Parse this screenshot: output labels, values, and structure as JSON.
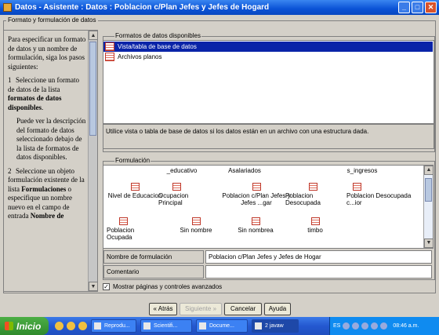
{
  "window": {
    "title": "Datos - Asistente : Datos : Poblacion c/Plan Jefes y Jefes de Hogard",
    "buttons": {
      "minimize": "_",
      "maximize": "□",
      "close": "✕"
    }
  },
  "group_title": "Formato y formulación de datos",
  "help": {
    "intro": "Para especificar un formato de datos y un nombre de formulación, siga los pasos siguientes:",
    "step1_num": "1",
    "step1_a": "Seleccione un formato de datos de la lista ",
    "step1_b": "formatos de datos disponibles",
    "step1_c": ".",
    "step1_note": "Puede ver la descripción del formato de datos seleccionado debajo de la lista de formatos de datos disponibles.",
    "step2_num": "2",
    "step2_a": "Seleccione un objeto formulación existente de la lista ",
    "step2_b": "Formulaciones",
    "step2_c": " o especifique un nombre nuevo en el campo de entrada ",
    "step2_d": "Nombre de"
  },
  "formats": {
    "label": "Formatos de datos disponibles",
    "items": [
      "Vista/tabla de base de datos",
      "Archivos planos"
    ],
    "selected": 0,
    "description": "Utilice vista o tabla de base de datos si los datos están en un archivo con una estructura dada."
  },
  "formulacion": {
    "label": "Formulación",
    "top_row": [
      "_educativo",
      "Asalariados",
      "s_ingresos"
    ],
    "items": [
      "Nivel de Educacion",
      "Ocupacion Principal",
      "Poblacion c/Plan Jefes y Jefes ...gar",
      "Poblacion Desocupada",
      "Poblacion Desocupada c...ior",
      "Poblacion Ocupada",
      "Sin nombre",
      "Sin nombrea",
      "timbo"
    ]
  },
  "fields": {
    "name_label": "Nombre de formulación",
    "name_value": "Poblacion c/Plan Jefes y Jefes de Hogar",
    "comment_label": "Comentario",
    "comment_value": ""
  },
  "advanced_checkbox": {
    "label": "Mostrar páginas y controles avanzados",
    "checked": "✓"
  },
  "buttons": {
    "back": "« Atrás",
    "next": "Siguiente »",
    "cancel": "Cancelar",
    "help": "Ayuda"
  },
  "taskbar": {
    "start": "Inicio",
    "items": [
      "Reprodu...",
      "Scientifi...",
      "Docume...",
      "2 javaw"
    ],
    "lang": "ES",
    "clock": "08:46 a.m."
  }
}
